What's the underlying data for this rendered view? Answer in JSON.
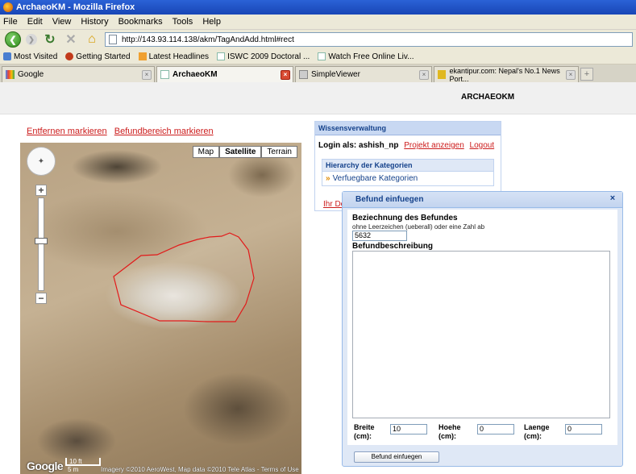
{
  "window": {
    "title": "ArchaeoKM - Mozilla Firefox"
  },
  "menu": [
    "File",
    "Edit",
    "View",
    "History",
    "Bookmarks",
    "Tools",
    "Help"
  ],
  "nav": {
    "url": "http://143.93.114.138/akm/TagAndAdd.html#rect"
  },
  "bookmarks": [
    "Most Visited",
    "Getting Started",
    "Latest Headlines",
    "ISWC 2009 Doctoral ...",
    "Watch Free Online Liv..."
  ],
  "tabs": [
    {
      "label": "Google"
    },
    {
      "label": "ArchaeoKM"
    },
    {
      "label": "SimpleViewer"
    },
    {
      "label": "ekantipur.com: Nepal's No.1 News Port..."
    }
  ],
  "page": {
    "brand": "ARCHAEOKM",
    "map_links": {
      "remove": "Entfernen markieren",
      "area": "Befundbereich markieren"
    },
    "map": {
      "types": [
        "Map",
        "Satellite",
        "Terrain"
      ],
      "selected_type": "Satellite",
      "scale_ft": "10 ft",
      "scale_m": "5 m",
      "attribution": "Imagery ©2010 AeroWest, Map data ©2010 Tele Atlas - Terms of Use",
      "logo": "Google"
    },
    "wissensverwaltung": {
      "title": "Wissensverwaltung",
      "login_prefix": "Login als:",
      "user": "ashish_np",
      "project_link": "Projekt anzeigen",
      "logout": "Logout",
      "hier_title": "Hierarchy der Kategorien",
      "hier_item": "Verfuegbare Kategorien",
      "partial": "Ihr Do"
    },
    "dialog": {
      "title": "Befund einfuegen",
      "label_name": "Beziechnung des Befundes",
      "hint": "ohne Leerzeichen (ueberall) oder eine Zahl ab",
      "name_value": "5632",
      "label_desc": "Befundbeschreibung",
      "breite_label": "Breite (cm):",
      "breite_value": "10",
      "hoehe_label": "Hoehe (cm):",
      "hoehe_value": "0",
      "laenge_label": "Laenge (cm):",
      "laenge_value": "0",
      "submit": "Befund einfuegen"
    }
  }
}
